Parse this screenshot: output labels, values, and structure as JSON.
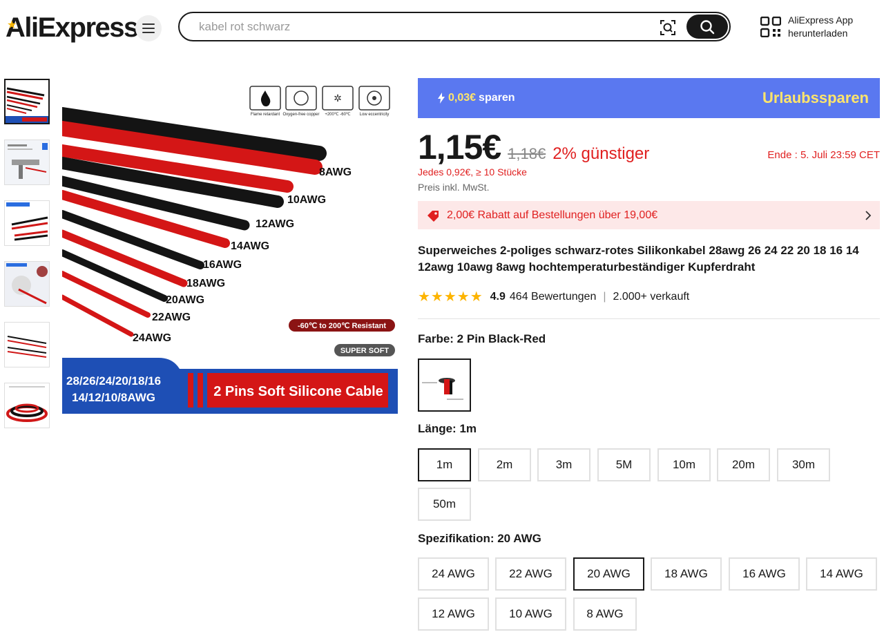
{
  "header": {
    "logo_text": "AliExpress",
    "search_placeholder": "kabel rot schwarz",
    "app_line1": "AliExpress App",
    "app_line2": "herunterladen"
  },
  "promo": {
    "save_amount": "0,03€",
    "save_word": "sparen",
    "campaign": "Urlaubssparen"
  },
  "price": {
    "current": "1,15€",
    "original": "1,18€",
    "discount": "2% günstiger",
    "ends": "Ende :  5. Juli 23:59 CET",
    "bulk": "Jedes 0,92€, ≥ 10 Stücke",
    "vat": "Preis inkl. MwSt."
  },
  "coupon": {
    "text": "2,00€ Rabatt auf Bestellungen über 19,00€"
  },
  "product": {
    "title": "Superweiches 2-poliges schwarz-rotes Silikonkabel 28awg 26 24 22 20 18 16 14 12awg 10awg 8awg hochtemperaturbeständiger Kupferdraht",
    "rating": "4.9",
    "reviews": "464 Bewertungen",
    "sold": "2.000+ verkauft",
    "stars": "★★★★★"
  },
  "image": {
    "icon_labels": [
      "Flame retardant",
      "Oxygen-free copper",
      "+200℃ -60℃",
      "Low eccentricity"
    ],
    "awg_labels": [
      "8AWG",
      "10AWG",
      "12AWG",
      "14AWG",
      "16AWG",
      "18AWG",
      "20AWG",
      "22AWG",
      "24AWG"
    ],
    "resistant": "-60℃ to 200℃ Resistant",
    "super_soft": "SUPER SOFT",
    "banner_left_1": "28/26/24/20/18/16",
    "banner_left_2": "14/12/10/8AWG",
    "banner_right": "2 Pins Soft Silicone Cable"
  },
  "color": {
    "label": "Farbe: 2 Pin Black-Red"
  },
  "length": {
    "label": "Länge: 1m",
    "options": [
      "1m",
      "2m",
      "3m",
      "5M",
      "10m",
      "20m",
      "30m",
      "50m"
    ],
    "selected": "1m"
  },
  "spec": {
    "label": "Spezifikation: 20 AWG",
    "options": [
      "24 AWG",
      "22 AWG",
      "20 AWG",
      "18 AWG",
      "16 AWG",
      "14 AWG",
      "12 AWG",
      "10 AWG",
      "8 AWG"
    ],
    "selected": "20 AWG"
  },
  "colors": {
    "red": "#e02020",
    "promo_blue": "#5a78f0",
    "promo_yellow": "#ffe56b",
    "star": "#fdb400"
  }
}
